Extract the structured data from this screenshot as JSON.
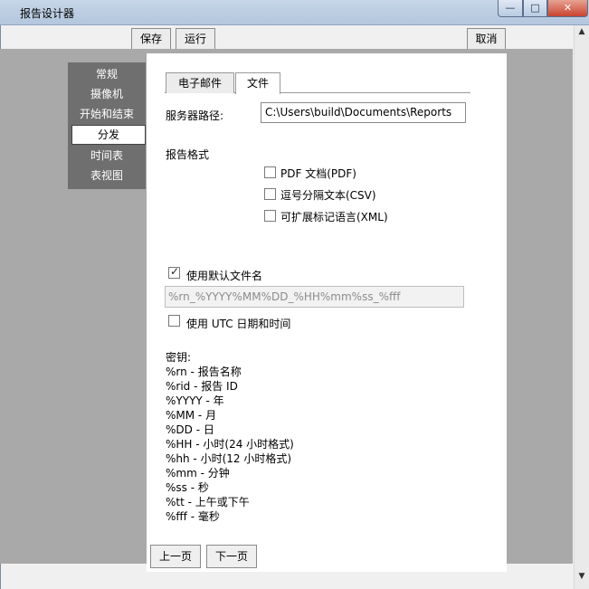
{
  "window": {
    "title": "报告设计器",
    "controls": {
      "minimize": "—",
      "maximize": "□",
      "close": "✕"
    }
  },
  "toolbar": {
    "save_label": "保存",
    "run_label": "运行",
    "cancel_label": "取消"
  },
  "sidebar": {
    "items": [
      {
        "label": "常规"
      },
      {
        "label": "摄像机"
      },
      {
        "label": "开始和结束"
      },
      {
        "label": "分发"
      },
      {
        "label": "时间表"
      },
      {
        "label": "表视图"
      }
    ],
    "active_label": "分发"
  },
  "tabs": [
    {
      "label": "电子邮件"
    },
    {
      "label": "文件"
    }
  ],
  "active_tab": "文件",
  "server_path": {
    "label": "服务器路径:",
    "value": "C:\\Users\\build\\Documents\\Reports"
  },
  "report_format": {
    "label": "报告格式",
    "options": [
      {
        "label": "PDF 文档(PDF)",
        "checked": false
      },
      {
        "label": "逗号分隔文本(CSV)",
        "checked": false
      },
      {
        "label": "可扩展标记语言(XML)",
        "checked": false
      }
    ]
  },
  "default_filename": {
    "label": "使用默认文件名",
    "checked": true,
    "value": "%rn_%YYYY%MM%DD_%HH%mm%ss_%fff"
  },
  "utc": {
    "label": "使用 UTC 日期和时间",
    "checked": false
  },
  "keys": {
    "heading": "密钥:",
    "lines": [
      "%rn - 报告名称",
      "%rid - 报告 ID",
      "%YYYY - 年",
      "%MM - 月",
      "%DD - 日",
      "%HH - 小时(24 小时格式)",
      "%hh - 小时(12 小时格式)",
      "%mm - 分钟",
      "%ss - 秒",
      "%tt - 上午或下午",
      "%fff - 毫秒"
    ]
  },
  "pager": {
    "prev_label": "上一页",
    "next_label": "下一页"
  },
  "scrollbar": {
    "up": "▲",
    "down": "▼"
  },
  "colors": {
    "panel_bg": "#ffffff",
    "canvas_bg": "#a9a9a9",
    "sidebar_bg": "#6f6f6f"
  }
}
